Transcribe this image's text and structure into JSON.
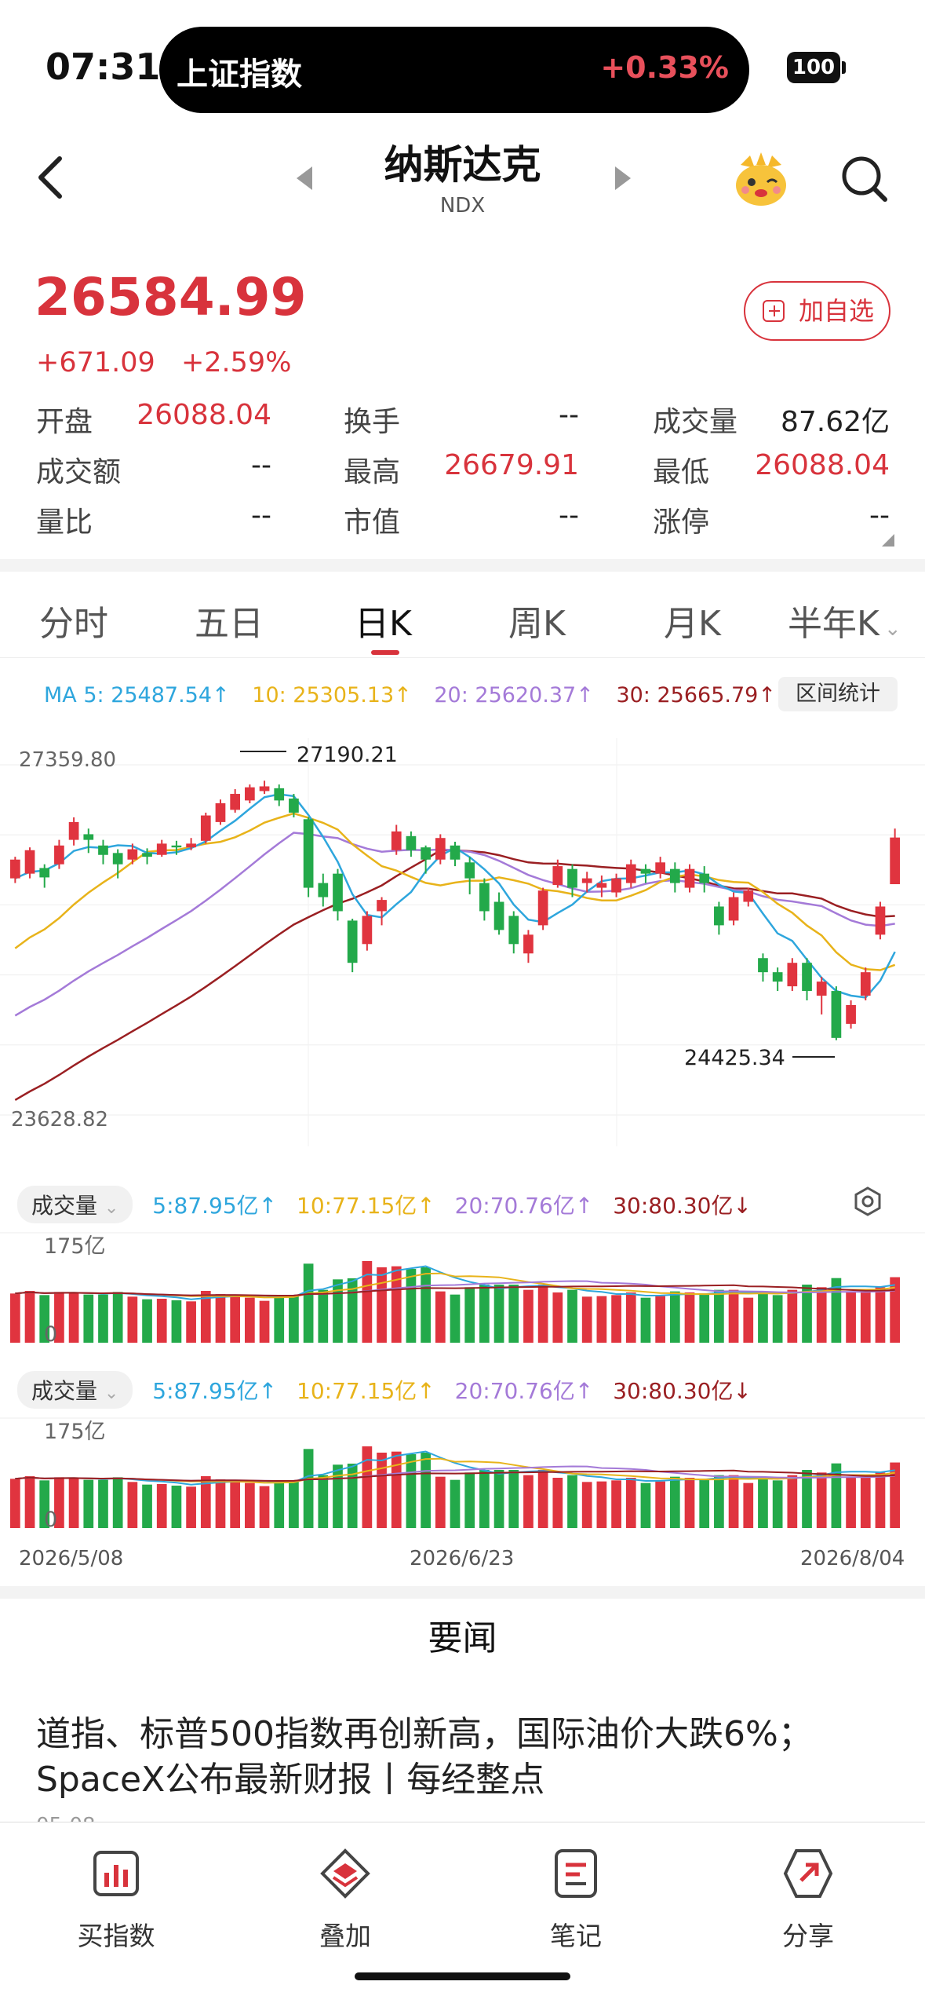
{
  "status_bar": {
    "time": "07:31",
    "island_name": "上证指数",
    "island_change": "+0.33%",
    "battery": "100"
  },
  "header": {
    "title": "纳斯达克",
    "code": "NDX"
  },
  "quote": {
    "price": "26584.99",
    "change_abs": "+671.09",
    "change_pct": "+2.59%",
    "watch_label": "加自选",
    "stats": [
      {
        "label": "开盘",
        "value": "26088.04"
      },
      {
        "label": "换手",
        "value": "--"
      },
      {
        "label": "成交量",
        "value": "87.62亿"
      },
      {
        "label": "成交额",
        "value": "--"
      },
      {
        "label": "最高",
        "value": "26679.91"
      },
      {
        "label": "最低",
        "value": "26088.04"
      },
      {
        "label": "量比",
        "value": "--"
      },
      {
        "label": "市值",
        "value": "--"
      },
      {
        "label": "涨停",
        "value": "--"
      }
    ]
  },
  "tabs": [
    "分时",
    "五日",
    "日K",
    "周K",
    "月K",
    "半年K"
  ],
  "active_tab": "日K",
  "ma": {
    "ma5": "MA 5: 25487.54↑",
    "ma10": "10: 25305.13↑",
    "ma20": "20: 25620.37↑",
    "ma30": "30: 25665.79↑",
    "range_label": "区间统计"
  },
  "kline": {
    "y_top_label": "27359.80",
    "y_bottom_label": "23628.82",
    "high_marker": "27190.21",
    "low_marker": "24425.34"
  },
  "volume_panels": [
    {
      "selector": "成交量",
      "m5": "5:87.95亿↑",
      "m10": "10:77.15亿↑",
      "m20": "20:70.76亿↑",
      "m30": "30:80.30亿↓",
      "max_label": "175亿",
      "zero_label": "0"
    },
    {
      "selector": "成交量",
      "m5": "5:87.95亿↑",
      "m10": "10:77.15亿↑",
      "m20": "20:70.76亿↑",
      "m30": "30:80.30亿↓",
      "max_label": "175亿",
      "zero_label": "0"
    }
  ],
  "dates": [
    "2026/5/08",
    "2026/6/23",
    "2026/8/04"
  ],
  "news": {
    "section_title": "要闻",
    "headline": "道指、标普500指数再创新高，国际油价大跌6%；SpaceX公布最新财报丨每经整点",
    "meta_cut": "05-08"
  },
  "bottom_bar": [
    {
      "label": "买指数",
      "icon": "chart-bars-icon"
    },
    {
      "label": "叠加",
      "icon": "layers-icon"
    },
    {
      "label": "笔记",
      "icon": "note-icon"
    },
    {
      "label": "分享",
      "icon": "share-icon"
    }
  ],
  "colors": {
    "up": "#e0343f",
    "down": "#23a94a",
    "ma5": "#2ea6dd",
    "ma10": "#e8b31a",
    "ma20": "#a47ad8",
    "ma30": "#9a1f22"
  },
  "chart_data": {
    "type": "candlestick",
    "y_range": [
      23628.82,
      27359.8
    ],
    "candles": [
      [
        26150,
        26350,
        26100,
        26380
      ],
      [
        26200,
        26450,
        26150,
        26480
      ],
      [
        26260,
        26160,
        26050,
        26300
      ],
      [
        26300,
        26500,
        26250,
        26560
      ],
      [
        26560,
        26750,
        26500,
        26800
      ],
      [
        26620,
        26560,
        26420,
        26680
      ],
      [
        26500,
        26400,
        26300,
        26560
      ],
      [
        26420,
        26300,
        26150,
        26460
      ],
      [
        26350,
        26460,
        26300,
        26520
      ],
      [
        26420,
        26380,
        26300,
        26470
      ],
      [
        26400,
        26520,
        26380,
        26560
      ],
      [
        26500,
        26480,
        26400,
        26550
      ],
      [
        26480,
        26520,
        26450,
        26580
      ],
      [
        26550,
        26820,
        26520,
        26850
      ],
      [
        26750,
        26950,
        26720,
        26990
      ],
      [
        26880,
        27050,
        26850,
        27100
      ],
      [
        26980,
        27120,
        26950,
        27150
      ],
      [
        27080,
        27130,
        27050,
        27190.21
      ],
      [
        27110,
        26980,
        26920,
        27150
      ],
      [
        27000,
        26850,
        26800,
        27050
      ],
      [
        26780,
        26050,
        25950,
        26800
      ],
      [
        26100,
        25950,
        25850,
        26200
      ],
      [
        26200,
        25800,
        25700,
        26250
      ],
      [
        25700,
        25250,
        25150,
        25720
      ],
      [
        25450,
        25750,
        25380,
        25800
      ],
      [
        25800,
        25920,
        25650,
        25950
      ],
      [
        26450,
        26650,
        26400,
        26720
      ],
      [
        26600,
        26450,
        26380,
        26650
      ],
      [
        26480,
        26350,
        26200,
        26500
      ],
      [
        26350,
        26580,
        26300,
        26620
      ],
      [
        26500,
        26350,
        26280,
        26540
      ],
      [
        26320,
        26150,
        25980,
        26380
      ],
      [
        26100,
        25800,
        25700,
        26150
      ],
      [
        25900,
        25600,
        25550,
        26000
      ],
      [
        25750,
        25450,
        25350,
        25800
      ],
      [
        25350,
        25550,
        25250,
        25600
      ],
      [
        25650,
        26020,
        25600,
        26050
      ],
      [
        26080,
        26280,
        26050,
        26350
      ],
      [
        26250,
        26050,
        25950,
        26300
      ],
      [
        26100,
        26150,
        26000,
        26220
      ],
      [
        26050,
        26100,
        25950,
        26180
      ],
      [
        26000,
        26150,
        25950,
        26200
      ],
      [
        26100,
        26300,
        26050,
        26350
      ],
      [
        26250,
        26200,
        26100,
        26300
      ],
      [
        26200,
        26320,
        26150,
        26380
      ],
      [
        26250,
        26100,
        26000,
        26320
      ],
      [
        26050,
        26250,
        26000,
        26300
      ],
      [
        26200,
        26100,
        26000,
        26280
      ],
      [
        25850,
        25650,
        25550,
        25900
      ],
      [
        25700,
        25950,
        25650,
        26000
      ],
      [
        25900,
        26020,
        25850,
        26050
      ],
      [
        25300,
        25150,
        25050,
        25350
      ],
      [
        25150,
        25050,
        24950,
        25200
      ],
      [
        25000,
        25250,
        24950,
        25300
      ],
      [
        25250,
        24950,
        24850,
        25300
      ],
      [
        24900,
        25050,
        24700,
        25100
      ],
      [
        24950,
        24450,
        24425.34,
        25000
      ],
      [
        24600,
        24800,
        24550,
        24850
      ],
      [
        24900,
        25150,
        24850,
        25200
      ],
      [
        25550,
        25850,
        25500,
        25900
      ],
      [
        26088.04,
        26584.99,
        26088.04,
        26679.91
      ]
    ]
  }
}
